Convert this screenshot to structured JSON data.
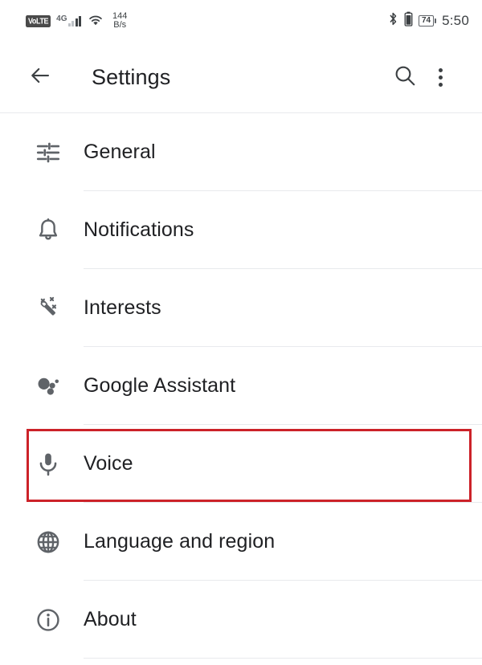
{
  "status_bar": {
    "volte_badge": "VoLTE",
    "network_type": "4G",
    "data_speed_value": "144",
    "data_speed_unit": "B/s",
    "bluetooth_icon": "bluetooth-icon",
    "battery_small_icon": "battery-icon",
    "battery_percent": "74",
    "clock": "5:50"
  },
  "app_bar": {
    "back_icon": "back-arrow-icon",
    "title": "Settings",
    "search_icon": "search-icon",
    "overflow_icon": "overflow-menu-icon"
  },
  "settings_list": {
    "items": [
      {
        "label": "General",
        "icon": "tune-icon"
      },
      {
        "label": "Notifications",
        "icon": "bell-icon"
      },
      {
        "label": "Interests",
        "icon": "magic-wand-icon"
      },
      {
        "label": "Google Assistant",
        "icon": "google-assistant-icon"
      },
      {
        "label": "Voice",
        "icon": "microphone-icon"
      },
      {
        "label": "Language and region",
        "icon": "globe-icon"
      },
      {
        "label": "About",
        "icon": "info-icon"
      }
    ]
  },
  "annotation": {
    "highlight_color": "#cc2229",
    "highlighted_item": "Voice"
  },
  "colors": {
    "background": "#ffffff",
    "text_primary": "#202124",
    "icon": "#5f6368",
    "divider": "#e8eaed"
  }
}
